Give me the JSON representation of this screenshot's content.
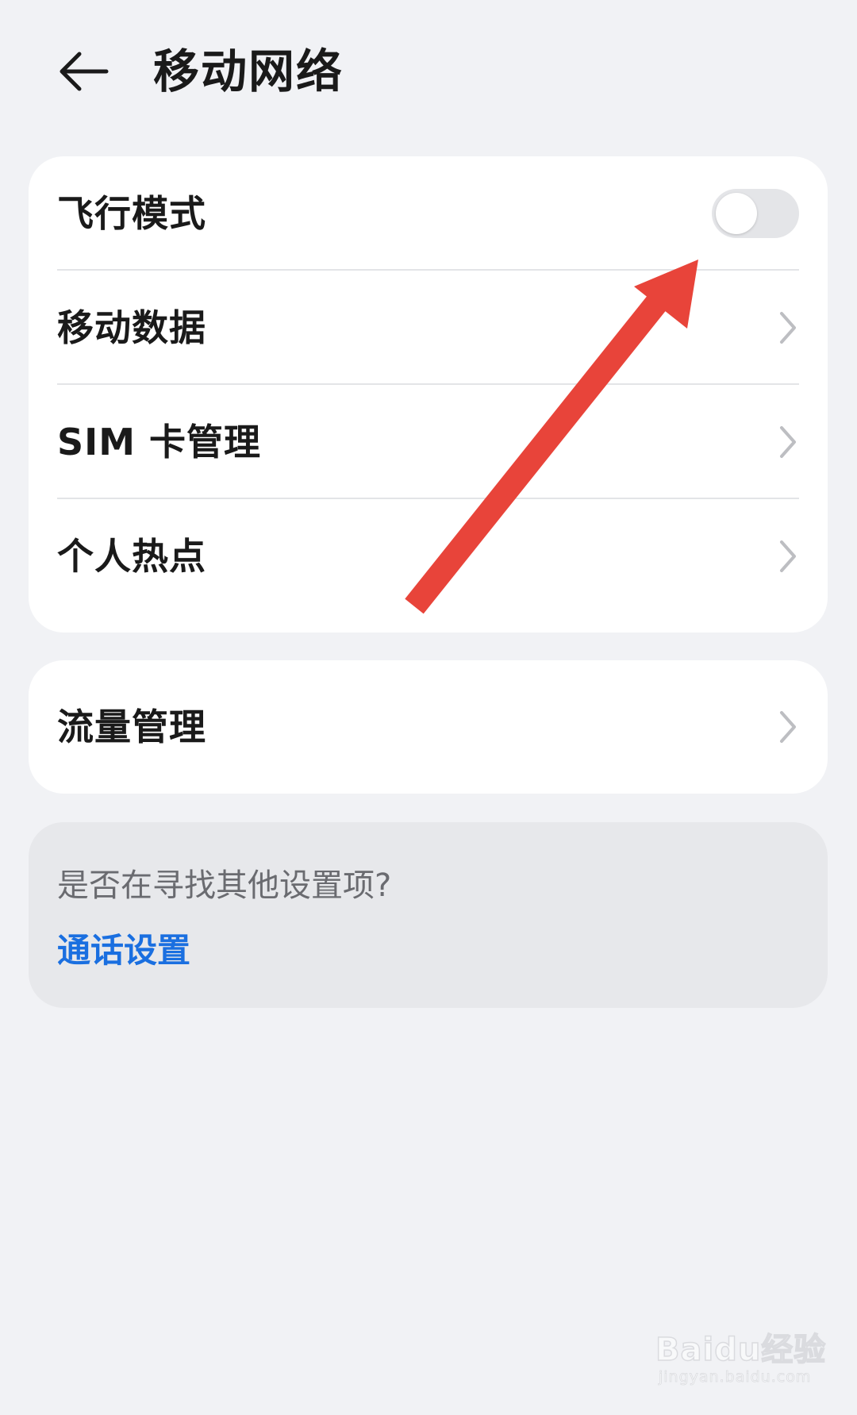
{
  "header": {
    "title": "移动网络",
    "back_icon": "arrow-left-icon"
  },
  "main_card": {
    "items": [
      {
        "label": "飞行模式",
        "control": "toggle",
        "toggle_on": false
      },
      {
        "label": "移动数据",
        "control": "chevron"
      },
      {
        "label": "SIM 卡管理",
        "control": "chevron"
      },
      {
        "label": "个人热点",
        "control": "chevron"
      }
    ]
  },
  "traffic_card": {
    "label": "流量管理",
    "control": "chevron"
  },
  "hint_card": {
    "question": "是否在寻找其他设置项?",
    "link": "通话设置"
  },
  "annotation": {
    "arrow_color": "#e8443a",
    "points_to": "flight-mode-toggle"
  },
  "watermark": {
    "logo_text": "Baidu经验",
    "url_text": "jingyan.baidu.com"
  },
  "colors": {
    "background": "#f1f2f5",
    "card": "#ffffff",
    "hint_card": "#e7e8eb",
    "link": "#1a6fe0",
    "toggle_off": "#e4e5e8"
  }
}
